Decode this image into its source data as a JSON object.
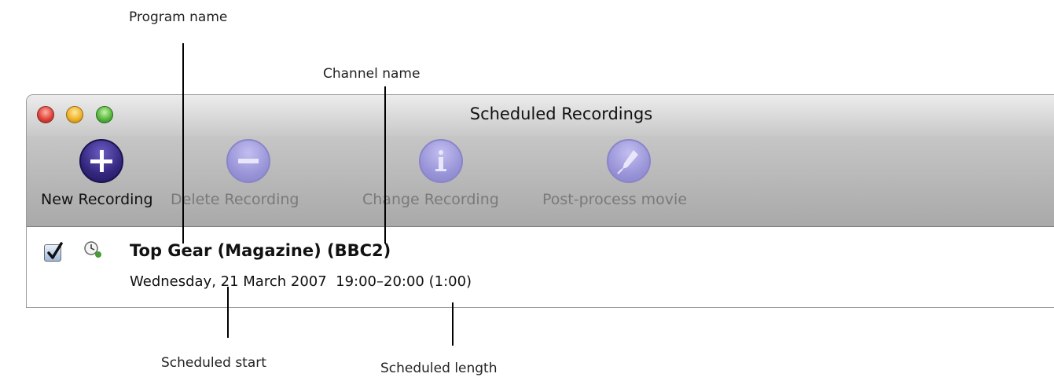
{
  "callouts": {
    "program_name": "Program name",
    "channel_name": "Channel name",
    "scheduled_start": "Scheduled start",
    "scheduled_length": "Scheduled length"
  },
  "window": {
    "title": "Scheduled Recordings"
  },
  "toolbar": {
    "new_recording": "New Recording",
    "delete_recording": "Delete Recording",
    "change_recording": "Change Recording",
    "post_process_movie": "Post-process movie"
  },
  "recording": {
    "checked": true,
    "title": "Top Gear (Magazine) (BBC2)",
    "when": "Wednesday, 21 March 2007  19:00–20:00 (1:00)"
  },
  "icons": {
    "new": "plus-icon",
    "delete": "minus-icon",
    "change": "info-icon",
    "post_process": "pen-icon",
    "schedule": "clock-icon"
  },
  "colors": {
    "enabled_icon": "#3a2f8a",
    "disabled_icon": "#9d97d6"
  }
}
